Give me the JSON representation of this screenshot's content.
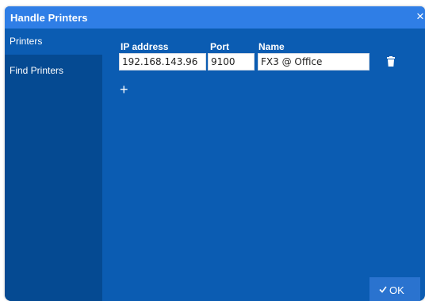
{
  "dialog": {
    "title": "Handle Printers",
    "close_glyph": "×"
  },
  "sidebar": {
    "items": [
      {
        "label": "Printers",
        "active": true
      },
      {
        "label": "Find Printers",
        "active": false
      }
    ]
  },
  "printers_table": {
    "columns": [
      "IP address",
      "Port",
      "Name"
    ],
    "rows": [
      {
        "ip": "192.168.143.96",
        "port": "9100",
        "name": "FX3 @ Office"
      }
    ]
  },
  "add_glyph": "+",
  "footer": {
    "ok_label": "OK"
  },
  "colors": {
    "titlebar": "#2f7ee6",
    "content": "#0b5cb2",
    "sidebar": "#054a92",
    "ok_button": "#2a73cf"
  },
  "icons": {
    "close": "close-icon",
    "delete": "trash-icon",
    "add": "plus-icon",
    "confirm": "checkmark-icon"
  }
}
